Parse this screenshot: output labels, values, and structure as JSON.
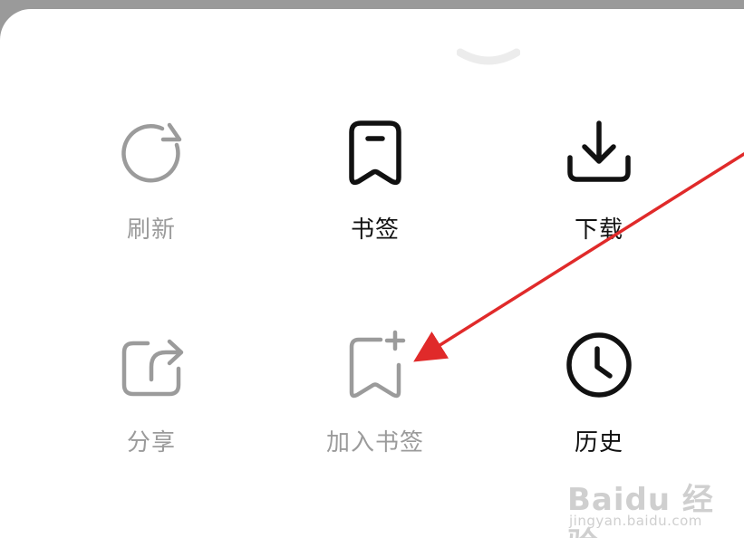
{
  "colors": {
    "dim": "#9b9b9b",
    "dark": "#111111",
    "arrow": "#e02a2a",
    "top_backdrop": "#9a9a9a"
  },
  "drag_handle": {
    "icon": "chevron-down-icon"
  },
  "menu": {
    "items": [
      {
        "label": "刷新",
        "icon": "refresh-icon",
        "state": "disabled"
      },
      {
        "label": "书签",
        "icon": "bookmark-icon",
        "state": "enabled"
      },
      {
        "label": "下载",
        "icon": "download-icon",
        "state": "enabled"
      },
      {
        "label": "分享",
        "icon": "share-icon",
        "state": "disabled"
      },
      {
        "label": "加入书签",
        "icon": "add-bookmark-icon",
        "state": "disabled"
      },
      {
        "label": "历史",
        "icon": "history-icon",
        "state": "enabled"
      }
    ]
  },
  "watermark": {
    "logo": "Baidu 经验",
    "url": "jingyan.baidu.com"
  }
}
